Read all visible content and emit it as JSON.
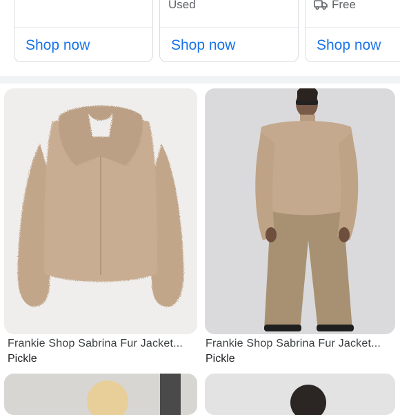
{
  "top_cards": [
    {
      "top_text": "",
      "button": "Shop now"
    },
    {
      "top_text": "Used",
      "button": "Shop now"
    },
    {
      "top_text": "Free",
      "top_icon": "delivery-truck-icon",
      "button": "Shop now"
    }
  ],
  "products": [
    {
      "title": "Frankie Shop Sabrina Fur Jacket...",
      "source": "Pickle",
      "image": "beige-fur-jacket-product-photo"
    },
    {
      "title": "Frankie Shop Sabrina Fur Jacket...",
      "source": "Pickle",
      "image": "model-wearing-fur-jacket-photo"
    }
  ],
  "colors": {
    "link": "#1a73e8",
    "fur": "#c4a98e",
    "trousers": "#a89172",
    "backdrop": "#d9d9db"
  }
}
